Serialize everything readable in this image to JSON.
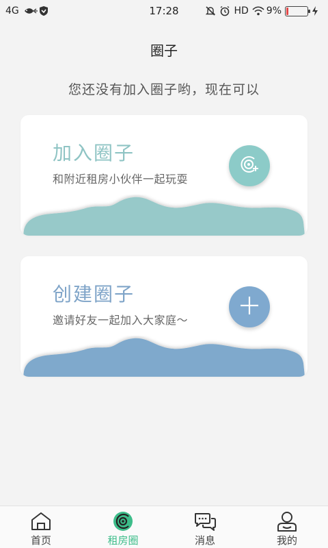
{
  "status_bar": {
    "network": "4G",
    "time": "17:28",
    "hd": "HD",
    "battery_percent": "9%",
    "battery_level": 0.09
  },
  "header": {
    "title": "圈子",
    "subtitle": "您还没有加入圈子哟，现在可以"
  },
  "cards": {
    "join": {
      "title": "加入圈子",
      "description": "和附近租房小伙伴一起玩耍",
      "icon": "add-circle-icon",
      "color": "#8ccbc8"
    },
    "create": {
      "title": "创建圈子",
      "description": "邀请好友一起加入大家庭～",
      "icon": "plus-icon",
      "color": "#7fa9cf"
    }
  },
  "bottom_nav": {
    "items": [
      {
        "label": "首页",
        "icon": "home-icon"
      },
      {
        "label": "租房圈",
        "icon": "circle-icon"
      },
      {
        "label": "消息",
        "icon": "chat-icon"
      },
      {
        "label": "我的",
        "icon": "profile-icon"
      }
    ],
    "active_index": 1,
    "active_color": "#3dbd8a"
  }
}
